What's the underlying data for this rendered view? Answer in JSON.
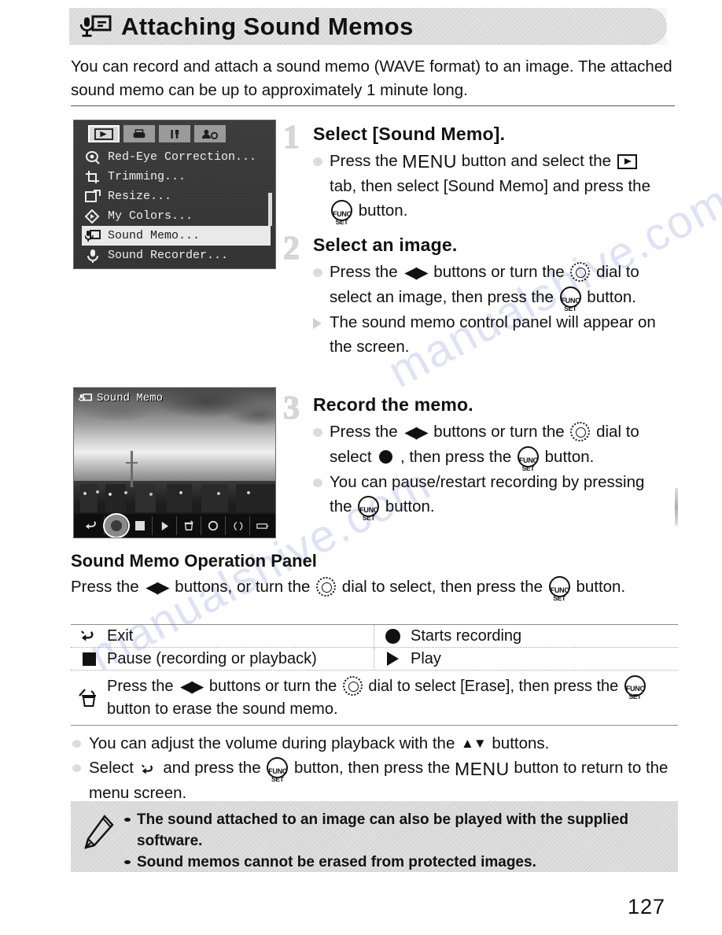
{
  "header": {
    "icon": "sound-memo-icon",
    "title": "Attaching Sound Memos"
  },
  "intro": "You can record and attach a sound memo (WAVE format) to an image. The attached sound memo can be up to approximately 1 minute long.",
  "menu_screenshot": {
    "tabs": [
      {
        "name": "playback-tab",
        "selected": true
      },
      {
        "name": "print-tab",
        "selected": false
      },
      {
        "name": "settings-tab",
        "selected": false
      },
      {
        "name": "my-camera-tab",
        "selected": false
      }
    ],
    "items": [
      {
        "label": "Red-Eye Correction...",
        "icon": "red-eye-icon",
        "selected": false
      },
      {
        "label": "Trimming...",
        "icon": "trimming-icon",
        "selected": false
      },
      {
        "label": "Resize...",
        "icon": "resize-icon",
        "selected": false
      },
      {
        "label": "My Colors...",
        "icon": "my-colors-icon",
        "selected": false
      },
      {
        "label": "Sound Memo...",
        "icon": "sound-memo-icon",
        "selected": true
      },
      {
        "label": "Sound Recorder...",
        "icon": "microphone-icon",
        "selected": false
      }
    ]
  },
  "photo_screenshot": {
    "label": "Sound Memo",
    "controls": [
      {
        "name": "exit-control",
        "glyph": "back-arrow"
      },
      {
        "name": "record-control",
        "glyph": "record-dot",
        "active": true
      },
      {
        "name": "stop-control",
        "glyph": "stop-square"
      },
      {
        "name": "play-control",
        "glyph": "play-triangle"
      },
      {
        "name": "erase-control",
        "glyph": "trash"
      },
      {
        "name": "time-control",
        "glyph": "circle"
      },
      {
        "name": "level-control",
        "glyph": "bracket"
      }
    ]
  },
  "steps": [
    {
      "number": "1",
      "title": "Select [Sound Memo].",
      "lines": [
        {
          "marker": "dot",
          "parts": [
            {
              "t": "text",
              "v": "Press the "
            },
            {
              "t": "glyph",
              "v": "MENU"
            },
            {
              "t": "text",
              "v": " button and select the "
            },
            {
              "t": "glyph",
              "v": "playback-tab-icon"
            },
            {
              "t": "text",
              "v": " tab, then select [Sound Memo] and press the "
            },
            {
              "t": "glyph",
              "v": "func-set-button"
            },
            {
              "t": "text",
              "v": " button."
            }
          ]
        }
      ]
    },
    {
      "number": "2",
      "title": "Select an image.",
      "lines": [
        {
          "marker": "dot",
          "parts": [
            {
              "t": "text",
              "v": "Press the "
            },
            {
              "t": "glyph",
              "v": "left-right-buttons"
            },
            {
              "t": "text",
              "v": " buttons or turn the "
            },
            {
              "t": "glyph",
              "v": "control-dial"
            },
            {
              "t": "text",
              "v": " dial to select an image, then press the "
            },
            {
              "t": "glyph",
              "v": "func-set-button"
            },
            {
              "t": "text",
              "v": " button."
            }
          ]
        },
        {
          "marker": "arrow",
          "parts": [
            {
              "t": "text",
              "v": "The sound memo control panel will appear on the screen."
            }
          ]
        }
      ]
    },
    {
      "number": "3",
      "title": "Record the memo.",
      "lines": [
        {
          "marker": "dot",
          "parts": [
            {
              "t": "text",
              "v": "Press the "
            },
            {
              "t": "glyph",
              "v": "left-right-buttons"
            },
            {
              "t": "text",
              "v": " buttons or turn the "
            },
            {
              "t": "glyph",
              "v": "control-dial"
            },
            {
              "t": "text",
              "v": " dial to select "
            },
            {
              "t": "glyph",
              "v": "record-dot"
            },
            {
              "t": "text",
              "v": " , then press the "
            },
            {
              "t": "glyph",
              "v": "func-set-button"
            },
            {
              "t": "text",
              "v": " button."
            }
          ]
        },
        {
          "marker": "dot",
          "parts": [
            {
              "t": "text",
              "v": "You can pause/restart recording by pressing the "
            },
            {
              "t": "glyph",
              "v": "func-set-button"
            },
            {
              "t": "text",
              "v": " button."
            }
          ]
        }
      ]
    }
  ],
  "operation_panel": {
    "heading": "Sound Memo Operation Panel",
    "subtitle_parts": [
      {
        "t": "text",
        "v": "Press the "
      },
      {
        "t": "glyph",
        "v": "left-right-buttons"
      },
      {
        "t": "text",
        "v": " buttons, or turn the "
      },
      {
        "t": "glyph",
        "v": "control-dial"
      },
      {
        "t": "text",
        "v": " dial to select, then press the "
      },
      {
        "t": "glyph",
        "v": "func-set-button"
      },
      {
        "t": "text",
        "v": " button."
      }
    ],
    "rows": [
      {
        "left": {
          "icon": "exit-icon",
          "label": "Exit"
        },
        "right": {
          "icon": "record-icon",
          "label": "Starts recording"
        }
      },
      {
        "left": {
          "icon": "pause-icon",
          "label": "Pause (recording or playback)"
        },
        "right": {
          "icon": "play-icon",
          "label": "Play"
        }
      }
    ],
    "erase_row": {
      "icon": "erase-icon",
      "parts": [
        {
          "t": "text",
          "v": "Press the "
        },
        {
          "t": "glyph",
          "v": "left-right-buttons"
        },
        {
          "t": "text",
          "v": " buttons or turn the "
        },
        {
          "t": "glyph",
          "v": "control-dial"
        },
        {
          "t": "text",
          "v": " dial to select [Erase], then press the "
        },
        {
          "t": "glyph",
          "v": "func-set-button"
        },
        {
          "t": "text",
          "v": " button to erase the sound memo."
        }
      ]
    }
  },
  "lower_bullets": [
    {
      "parts": [
        {
          "t": "text",
          "v": "You can adjust the volume during playback with the "
        },
        {
          "t": "glyph",
          "v": "up-down-buttons"
        },
        {
          "t": "text",
          "v": " buttons."
        }
      ]
    },
    {
      "parts": [
        {
          "t": "text",
          "v": "Select "
        },
        {
          "t": "glyph",
          "v": "exit-icon"
        },
        {
          "t": "text",
          "v": " and press the "
        },
        {
          "t": "glyph",
          "v": "func-set-button"
        },
        {
          "t": "text",
          "v": " button, then press the "
        },
        {
          "t": "glyph",
          "v": "MENU"
        },
        {
          "t": "text",
          "v": " button to return to the menu screen."
        }
      ]
    }
  ],
  "note_box": {
    "icon": "pencil-icon",
    "notes": [
      "The sound attached to an image can also be played with the supplied software.",
      "Sound memos cannot be erased from protected images."
    ]
  },
  "page_number": "127",
  "watermark_text": "manualshive.com",
  "colors": {
    "header_band": "#e4e4e4",
    "note_box": "#e2e2e2",
    "text": "#111111",
    "rule": "#555555",
    "step_number": "#d8d8d8"
  }
}
